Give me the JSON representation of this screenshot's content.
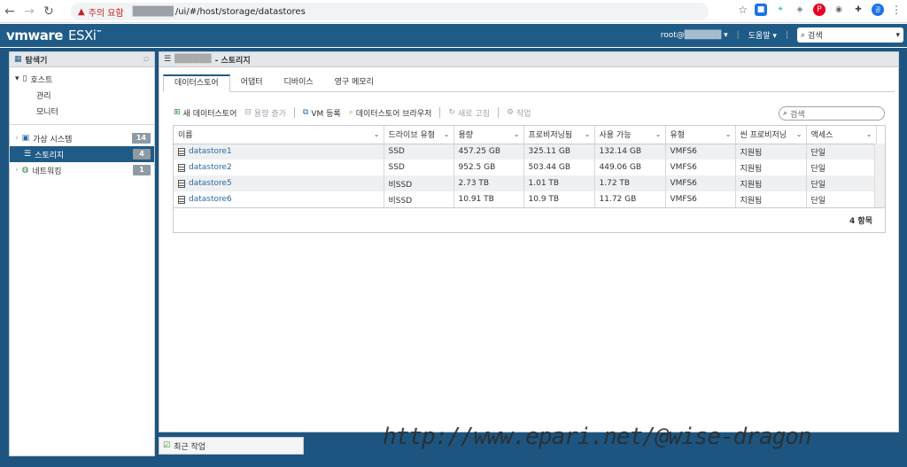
{
  "browser": {
    "warning": "주의 요함",
    "url_path": "/ui/#/host/storage/datastores"
  },
  "header": {
    "brand": "vmware ESXi",
    "user": "root@",
    "help": "도움말",
    "search_placeholder": "검색"
  },
  "nav": {
    "title": "탐색기",
    "host": "호스트",
    "manage": "관리",
    "monitor": "모니터",
    "vms": "가상 시스템",
    "vms_count": "14",
    "storage": "스토리지",
    "storage_count": "4",
    "network": "네트워킹",
    "network_count": "1"
  },
  "main": {
    "title": "- 스토리지",
    "tabs": [
      "데이터스토어",
      "어댑터",
      "디바이스",
      "영구 메모리"
    ],
    "toolbar": {
      "new_ds": "새 데이터스토어",
      "increase": "용량 증가",
      "register_vm": "VM 등록",
      "browser": "데이터스토어 브라우저",
      "refresh": "새로 고침",
      "actions": "작업"
    },
    "search_placeholder": "검색",
    "columns": [
      "이름",
      "드라이브 유형",
      "용량",
      "프로비저닝됨",
      "사용 가능",
      "유형",
      "씬 프로비저닝",
      "액세스"
    ],
    "rows": [
      [
        "datastore1",
        "SSD",
        "457.25 GB",
        "325.11 GB",
        "132.14 GB",
        "VMFS6",
        "지원됨",
        "단일"
      ],
      [
        "datastore2",
        "SSD",
        "952.5 GB",
        "503.44 GB",
        "449.06 GB",
        "VMFS6",
        "지원됨",
        "단일"
      ],
      [
        "datastore5",
        "비SSD",
        "2.73 TB",
        "1.01 TB",
        "1.72 TB",
        "VMFS6",
        "지원됨",
        "단일"
      ],
      [
        "datastore6",
        "비SSD",
        "10.91 TB",
        "10.9 TB",
        "11.72 GB",
        "VMFS6",
        "지원됨",
        "단일"
      ]
    ],
    "item_count": "4 항목"
  },
  "recent": "최근 작업",
  "watermark": "http://www.epari.net/@wise-dragon"
}
